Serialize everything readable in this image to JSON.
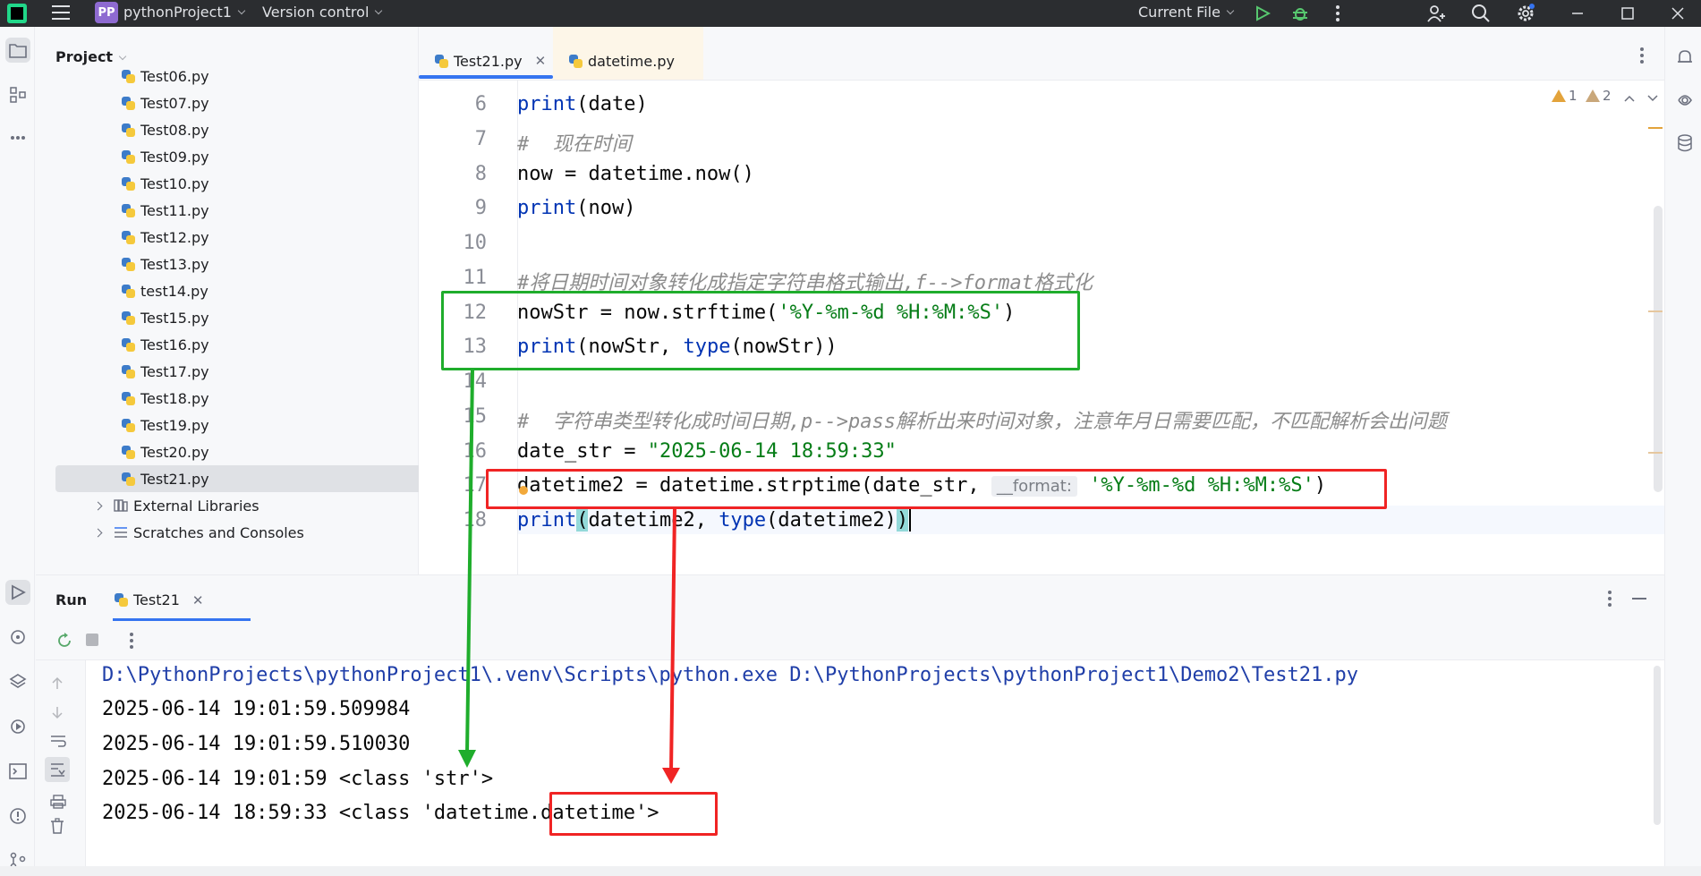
{
  "titlebar": {
    "project_badge": "PP",
    "project_name": "pythonProject1",
    "version_control": "Version control",
    "run_config": "Current File"
  },
  "project_panel": {
    "title": "Project",
    "files": [
      "Test06.py",
      "Test07.py",
      "Test08.py",
      "Test09.py",
      "Test10.py",
      "Test11.py",
      "Test12.py",
      "Test13.py",
      "test14.py",
      "Test15.py",
      "Test16.py",
      "Test17.py",
      "Test18.py",
      "Test19.py",
      "Test20.py",
      "Test21.py"
    ],
    "external_libraries": "External Libraries",
    "scratches": "Scratches and Consoles"
  },
  "editor": {
    "tabs": [
      {
        "label": "Test21.py"
      },
      {
        "label": "datetime.py"
      }
    ],
    "warnings": {
      "count_a": "1",
      "count_b": "2"
    },
    "line_numbers": [
      "6",
      "7",
      "8",
      "9",
      "10",
      "11",
      "12",
      "13",
      "14",
      "15",
      "16",
      "17",
      "18"
    ],
    "lines": {
      "l6_kw": "print",
      "l6_rest": "(date)",
      "l7": "#  现在时间",
      "l8": "now = datetime.now()",
      "l9_kw": "print",
      "l9_rest": "(now)",
      "l11": "#将日期时间对象转化成指定字符串格式输出,f-->format格式化",
      "l12_a": "nowStr = now.strftime(",
      "l12_str": "'%Y-%m-%d %H:%M:%S'",
      "l12_b": ")",
      "l13_kw": "print",
      "l13_a": "(nowStr, ",
      "l13_kw2": "type",
      "l13_b": "(nowStr))",
      "l15": "#  字符串类型转化成时间日期,p-->pass解析出来时间对象，注意年月日需要匹配，不匹配解析会出问题",
      "l16_a": "date_str = ",
      "l16_str": "\"2025-06-14 18:59:33\"",
      "l17_a": "datetime2 = datetime.strptime(date_str, ",
      "l17_hint": "__format:",
      "l17_str": "'%Y-%m-%d %H:%M:%S'",
      "l17_b": ")",
      "l18_kw": "print",
      "l18_p1": "(",
      "l18_a": "datetime2, ",
      "l18_kw2": "type",
      "l18_b": "(datetime2)",
      "l18_p2": ")"
    }
  },
  "run": {
    "title": "Run",
    "tab": "Test21",
    "output": [
      "D:\\PythonProjects\\pythonProject1\\.venv\\Scripts\\python.exe D:\\PythonProjects\\pythonProject1\\Demo2\\Test21.py",
      "2025-06-14 19:01:59.509984",
      "2025-06-14 19:01:59.510030",
      "2025-06-14 19:01:59 <class 'str'>",
      "2025-06-14 18:59:33 <class 'datetime.datetime'>"
    ]
  },
  "colors": {
    "annotation_green": "#1fad2c",
    "annotation_red": "#f02424",
    "accent": "#3574f0"
  }
}
